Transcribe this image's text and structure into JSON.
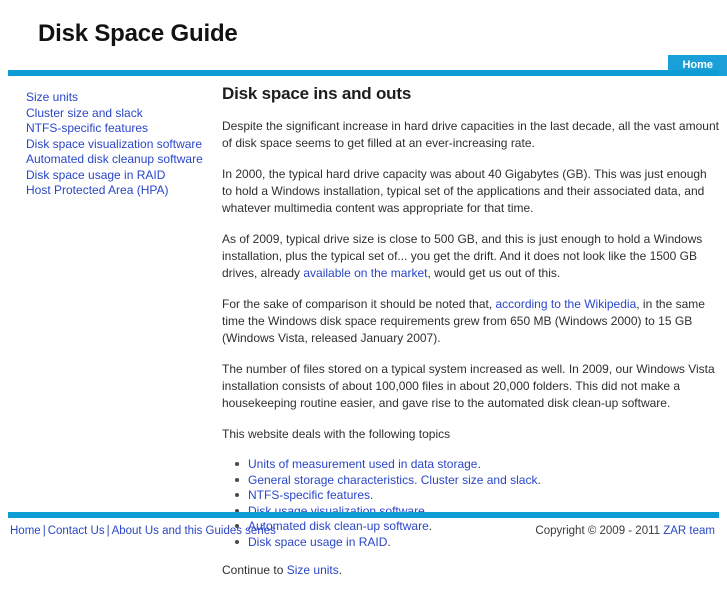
{
  "header": {
    "site_title": "Disk Space Guide",
    "tabs": [
      {
        "label": "Home",
        "name": "nav-tab-home"
      }
    ]
  },
  "colors": {
    "accent_bar": "#0b9dd4",
    "tab_bg": "#1b9fd8",
    "link": "#2a46c8",
    "text": "#2f2f2f"
  },
  "sidebar": {
    "items": [
      {
        "label": "Size units"
      },
      {
        "label": "Cluster size and slack"
      },
      {
        "label": "NTFS-specific features"
      },
      {
        "label": "Disk space visualization software"
      },
      {
        "label": "Automated disk cleanup software"
      },
      {
        "label": "Disk space usage in RAID"
      },
      {
        "label": "Host Protected Area (HPA)"
      }
    ]
  },
  "main": {
    "heading": "Disk space ins and outs",
    "paragraphs": {
      "p1": "Despite the significant increase in hard drive capacities in the last decade, all the vast amount of disk space seems to get filled at an ever-increasing rate.",
      "p2": "In 2000, the typical hard drive capacity was about 40 Gigabytes (GB). This was just enough to hold a Windows installation, typical set of the applications and their associated data, and whatever multimedia content was appropriate for that time.",
      "p3_before_link": "As of 2009, typical drive size is close to 500 GB, and this is just enough to hold a Windows installation, plus the typical set of... you get the drift. And it does not look like the 1500 GB drives, already ",
      "p3_link": "available on the market",
      "p3_after_link": ", would get us out of this.",
      "p4_before_link": "For the sake of comparison it should be noted that, ",
      "p4_link": "according to the Wikipedia",
      "p4_after_link": ", in the same time the Windows disk space requirements grew from 650 MB (Windows 2000) to 15 GB (Windows Vista, released January 2007).",
      "p5": "The number of files stored on a typical system increased as well. In 2009, our Windows Vista installation consists of about 100,000 files in about 20,000 folders. This did not make a housekeeping routine easier, and gave rise to the automated disk clean-up software.",
      "p6": "This website deals with the following topics"
    },
    "topics": [
      {
        "link": "Units of measurement used in data storage",
        "tail": "."
      },
      {
        "link": "General storage characteristics. Cluster size and slack",
        "tail": "."
      },
      {
        "link": "NTFS-specific features",
        "tail": "."
      },
      {
        "link": "Disk usage visualization software",
        "tail": "."
      },
      {
        "link": "Automated disk clean-up software",
        "tail": "."
      },
      {
        "link": "Disk space usage in RAID",
        "tail": "."
      }
    ],
    "continue": {
      "prefix": "Continue to ",
      "link": "Size units",
      "suffix": "."
    }
  },
  "footer": {
    "links": [
      {
        "label": "Home"
      },
      {
        "label": "Contact Us"
      },
      {
        "label": "About Us and this Guides series"
      }
    ],
    "separator": "|",
    "copyright_prefix": "Copyright © 2009 - 2011 ",
    "copyright_link": "ZAR team"
  }
}
